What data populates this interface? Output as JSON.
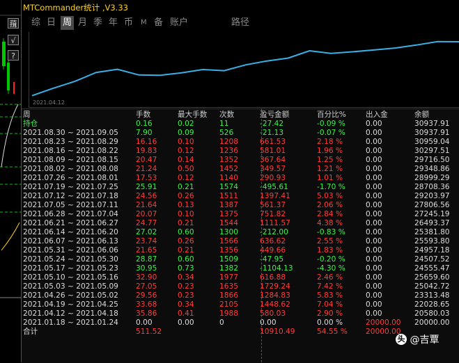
{
  "window": {
    "title": "MTCommander统计 ,V3.33"
  },
  "side": {
    "btn1": "䔱",
    "btn2": "√",
    "btn3": "?"
  },
  "tabs": [
    {
      "label": "综"
    },
    {
      "label": "日"
    },
    {
      "label": "周",
      "active": true
    },
    {
      "label": "月"
    },
    {
      "label": "季"
    },
    {
      "label": "年"
    },
    {
      "label": "币"
    },
    {
      "label": "M"
    },
    {
      "label": "备"
    },
    {
      "label": "账户"
    },
    {
      "label": "路径"
    }
  ],
  "chart": {
    "start_date": "2021.04.12"
  },
  "chart_data": {
    "type": "line",
    "x": [
      "2021.04.12",
      "2021.04.19",
      "2021.04.26",
      "2021.05.03",
      "2021.05.10",
      "2021.05.17",
      "2021.05.24",
      "2021.05.31",
      "2021.06.07",
      "2021.06.14",
      "2021.06.21",
      "2021.06.28",
      "2021.07.05",
      "2021.07.12",
      "2021.07.19",
      "2021.07.26",
      "2021.08.02",
      "2021.08.09",
      "2021.08.16",
      "2021.08.23",
      "2021.08.30"
    ],
    "series": [
      {
        "values": [
          20580.03,
          22028.65,
          23313.48,
          25042.72,
          25659.6,
          24555.47,
          24507.52,
          24957.18,
          25593.8,
          25381.8,
          26493.37,
          27245.19,
          27806.56,
          29203.97,
          28708.36,
          28999.29,
          29348.86,
          29716.5,
          30297.51,
          30959.04,
          30937.91
        ]
      }
    ],
    "ylim": [
      20000,
      32000
    ],
    "color": "#3ab0e8",
    "grid": false
  },
  "table": {
    "headers": [
      "周",
      "手数",
      "最大手数",
      "次数",
      "盈亏金额",
      "百分比%",
      "出入金",
      "余额"
    ],
    "holding": {
      "label": "持仓",
      "lots": "0.16",
      "max_lots": "0.02",
      "count": "11",
      "pnl": "-27.42",
      "pct": "-0.09 %",
      "io": "0.00",
      "balance": "30937.91"
    },
    "rows": [
      {
        "period": "2021.08.30 ~ 2021.09.05",
        "lots": "7.90",
        "max_lots": "0.09",
        "count": "526",
        "pnl": "-21.13",
        "pct": "-0.07 %",
        "io": "0.00",
        "balance": "30937.91",
        "dir": "neg"
      },
      {
        "period": "2021.08.23 ~ 2021.08.29",
        "lots": "16.16",
        "max_lots": "0.10",
        "count": "1208",
        "pnl": "661.53",
        "pct": "2.18 %",
        "io": "0.00",
        "balance": "30959.04",
        "dir": "pos"
      },
      {
        "period": "2021.08.16 ~ 2021.08.22",
        "lots": "19.83",
        "max_lots": "0.12",
        "count": "1236",
        "pnl": "581.01",
        "pct": "1.96 %",
        "io": "0.00",
        "balance": "30297.51",
        "dir": "pos"
      },
      {
        "period": "2021.08.09 ~ 2021.08.15",
        "lots": "20.47",
        "max_lots": "0.14",
        "count": "1352",
        "pnl": "367.64",
        "pct": "1.25 %",
        "io": "0.00",
        "balance": "29716.50",
        "dir": "pos"
      },
      {
        "period": "2021.08.02 ~ 2021.08.08",
        "lots": "21.24",
        "max_lots": "0.50",
        "count": "1452",
        "pnl": "349.57",
        "pct": "1.21 %",
        "io": "0.00",
        "balance": "29348.86",
        "dir": "pos"
      },
      {
        "period": "2021.07.26 ~ 2021.08.01",
        "lots": "17.53",
        "max_lots": "0.12",
        "count": "1140",
        "pnl": "290.93",
        "pct": "1.01 %",
        "io": "0.00",
        "balance": "28999.29",
        "dir": "pos"
      },
      {
        "period": "2021.07.19 ~ 2021.07.25",
        "lots": "25.91",
        "max_lots": "0.21",
        "count": "1574",
        "pnl": "-495.61",
        "pct": "-1.70 %",
        "io": "0.00",
        "balance": "28708.36",
        "dir": "neg"
      },
      {
        "period": "2021.07.12 ~ 2021.07.18",
        "lots": "24.56",
        "max_lots": "0.26",
        "count": "1511",
        "pnl": "1397.41",
        "pct": "5.03 %",
        "io": "0.00",
        "balance": "29203.97",
        "dir": "pos"
      },
      {
        "period": "2021.07.05 ~ 2021.07.11",
        "lots": "21.64",
        "max_lots": "0.13",
        "count": "1387",
        "pnl": "561.37",
        "pct": "2.06 %",
        "io": "0.00",
        "balance": "27806.56",
        "dir": "pos"
      },
      {
        "period": "2021.06.28 ~ 2021.07.04",
        "lots": "20.07",
        "max_lots": "0.10",
        "count": "1375",
        "pnl": "751.82",
        "pct": "2.84 %",
        "io": "0.00",
        "balance": "27245.19",
        "dir": "pos"
      },
      {
        "period": "2021.06.21 ~ 2021.06.27",
        "lots": "24.77",
        "max_lots": "0.21",
        "count": "1544",
        "pnl": "1111.57",
        "pct": "4.38 %",
        "io": "0.00",
        "balance": "26493.37",
        "dir": "pos"
      },
      {
        "period": "2021.06.14 ~ 2021.06.20",
        "lots": "27.02",
        "max_lots": "0.60",
        "count": "1300",
        "pnl": "-212.00",
        "pct": "-0.83 %",
        "io": "0.00",
        "balance": "25381.80",
        "dir": "neg"
      },
      {
        "period": "2021.06.07 ~ 2021.06.13",
        "lots": "23.74",
        "max_lots": "0.26",
        "count": "1566",
        "pnl": "636.62",
        "pct": "2.55 %",
        "io": "0.00",
        "balance": "25593.80",
        "dir": "pos"
      },
      {
        "period": "2021.05.31 ~ 2021.06.06",
        "lots": "21.65",
        "max_lots": "0.21",
        "count": "1356",
        "pnl": "449.66",
        "pct": "1.83 %",
        "io": "0.00",
        "balance": "24957.18",
        "dir": "pos"
      },
      {
        "period": "2021.05.24 ~ 2021.05.30",
        "lots": "28.87",
        "max_lots": "0.60",
        "count": "1509",
        "pnl": "-47.95",
        "pct": "-0.20 %",
        "io": "0.00",
        "balance": "24507.52",
        "dir": "neg"
      },
      {
        "period": "2021.05.17 ~ 2021.05.23",
        "lots": "30.95",
        "max_lots": "0.73",
        "count": "1382",
        "pnl": "-1104.13",
        "pct": "-4.30 %",
        "io": "0.00",
        "balance": "24555.47",
        "dir": "neg"
      },
      {
        "period": "2021.05.10 ~ 2021.05.16",
        "lots": "32.90",
        "max_lots": "0.34",
        "count": "1977",
        "pnl": "616.88",
        "pct": "2.46 %",
        "io": "0.00",
        "balance": "25659.60",
        "dir": "pos"
      },
      {
        "period": "2021.05.03 ~ 2021.05.09",
        "lots": "27.05",
        "max_lots": "0.23",
        "count": "1635",
        "pnl": "1729.24",
        "pct": "7.42 %",
        "io": "0.00",
        "balance": "25042.72",
        "dir": "pos"
      },
      {
        "period": "2021.04.26 ~ 2021.05.02",
        "lots": "29.56",
        "max_lots": "0.23",
        "count": "1866",
        "pnl": "1284.83",
        "pct": "5.83 %",
        "io": "0.00",
        "balance": "23313.48",
        "dir": "pos"
      },
      {
        "period": "2021.04.19 ~ 2021.04.25",
        "lots": "33.68",
        "max_lots": "0.34",
        "count": "2105",
        "pnl": "1448.62",
        "pct": "7.04 %",
        "io": "0.00",
        "balance": "22028.65",
        "dir": "pos"
      },
      {
        "period": "2021.04.12 ~ 2021.04.18",
        "lots": "35.86",
        "max_lots": "0.41",
        "count": "1988",
        "pnl": "580.03",
        "pct": "2.90 %",
        "io": "0.00",
        "balance": "20580.03",
        "dir": "pos"
      },
      {
        "period": "2021.01.18 ~ 2021.01.24",
        "lots": "0.00",
        "max_lots": "0.00",
        "count": "0",
        "pnl": "0.00",
        "pct": "0.00 %",
        "io": "20000.00",
        "balance": "20000.00",
        "dir": "wht"
      }
    ],
    "total": {
      "label": "合计",
      "lots": "511.52",
      "max_lots": "",
      "count": "",
      "pnl": "10910.49",
      "pct": "54.55 %",
      "io": "20000.00",
      "balance": ""
    }
  },
  "watermark": {
    "icon": "头",
    "text": "@吉覃"
  }
}
